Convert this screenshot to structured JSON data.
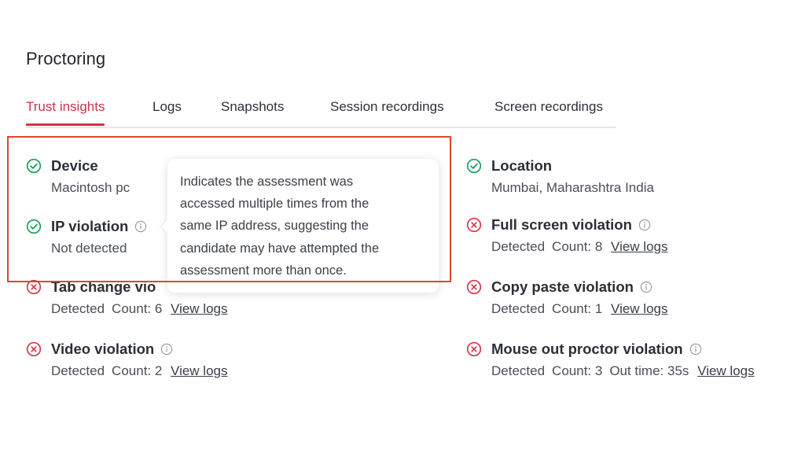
{
  "header": {
    "title": "Proctoring"
  },
  "tabs": [
    {
      "label": "Trust insights",
      "active": true
    },
    {
      "label": "Logs",
      "active": false
    },
    {
      "label": "Snapshots",
      "active": false
    },
    {
      "label": "Session recordings",
      "active": false
    },
    {
      "label": "Screen recordings",
      "active": false
    }
  ],
  "items": {
    "device": {
      "title": "Device",
      "value": "Macintosh pc",
      "status": "ok"
    },
    "ip_violation": {
      "title": "IP violation",
      "value": "Not detected",
      "status": "ok"
    },
    "tab_change": {
      "title": "Tab change vio",
      "status_text": "Detected",
      "count": "Count: 6",
      "link": "View logs",
      "status": "violation"
    },
    "video": {
      "title": "Video violation",
      "status_text": "Detected",
      "count": "Count: 2",
      "link": "View logs",
      "status": "violation"
    },
    "location": {
      "title": "Location",
      "value": "Mumbai, Maharashtra India",
      "status": "ok"
    },
    "full_screen": {
      "title": "Full screen violation",
      "status_text": "Detected",
      "count": "Count: 8",
      "link": "View logs",
      "status": "violation"
    },
    "copy_paste": {
      "title": "Copy paste violation",
      "status_text": "Detected",
      "count": "Count: 1",
      "link": "View logs",
      "status": "violation"
    },
    "mouse_out": {
      "title": "Mouse out proctor violation",
      "status_text": "Detected",
      "count": "Count: 3",
      "out_time": "Out time: 35s",
      "link": "View logs",
      "status": "violation"
    }
  },
  "tooltip": {
    "lines": [
      "Indicates the assessment was",
      "accessed multiple times from the",
      "same IP address, suggesting the",
      "candidate may have attempted the",
      "assessment more than once."
    ]
  },
  "colors": {
    "accent": "#d0334a",
    "ok_green": "#1e9e5a",
    "violation_red": "#d6394b",
    "highlight_border": "#e0452f"
  },
  "icons": {
    "ok": "check-circle-icon",
    "violation": "x-circle-icon",
    "info": "info-icon"
  }
}
